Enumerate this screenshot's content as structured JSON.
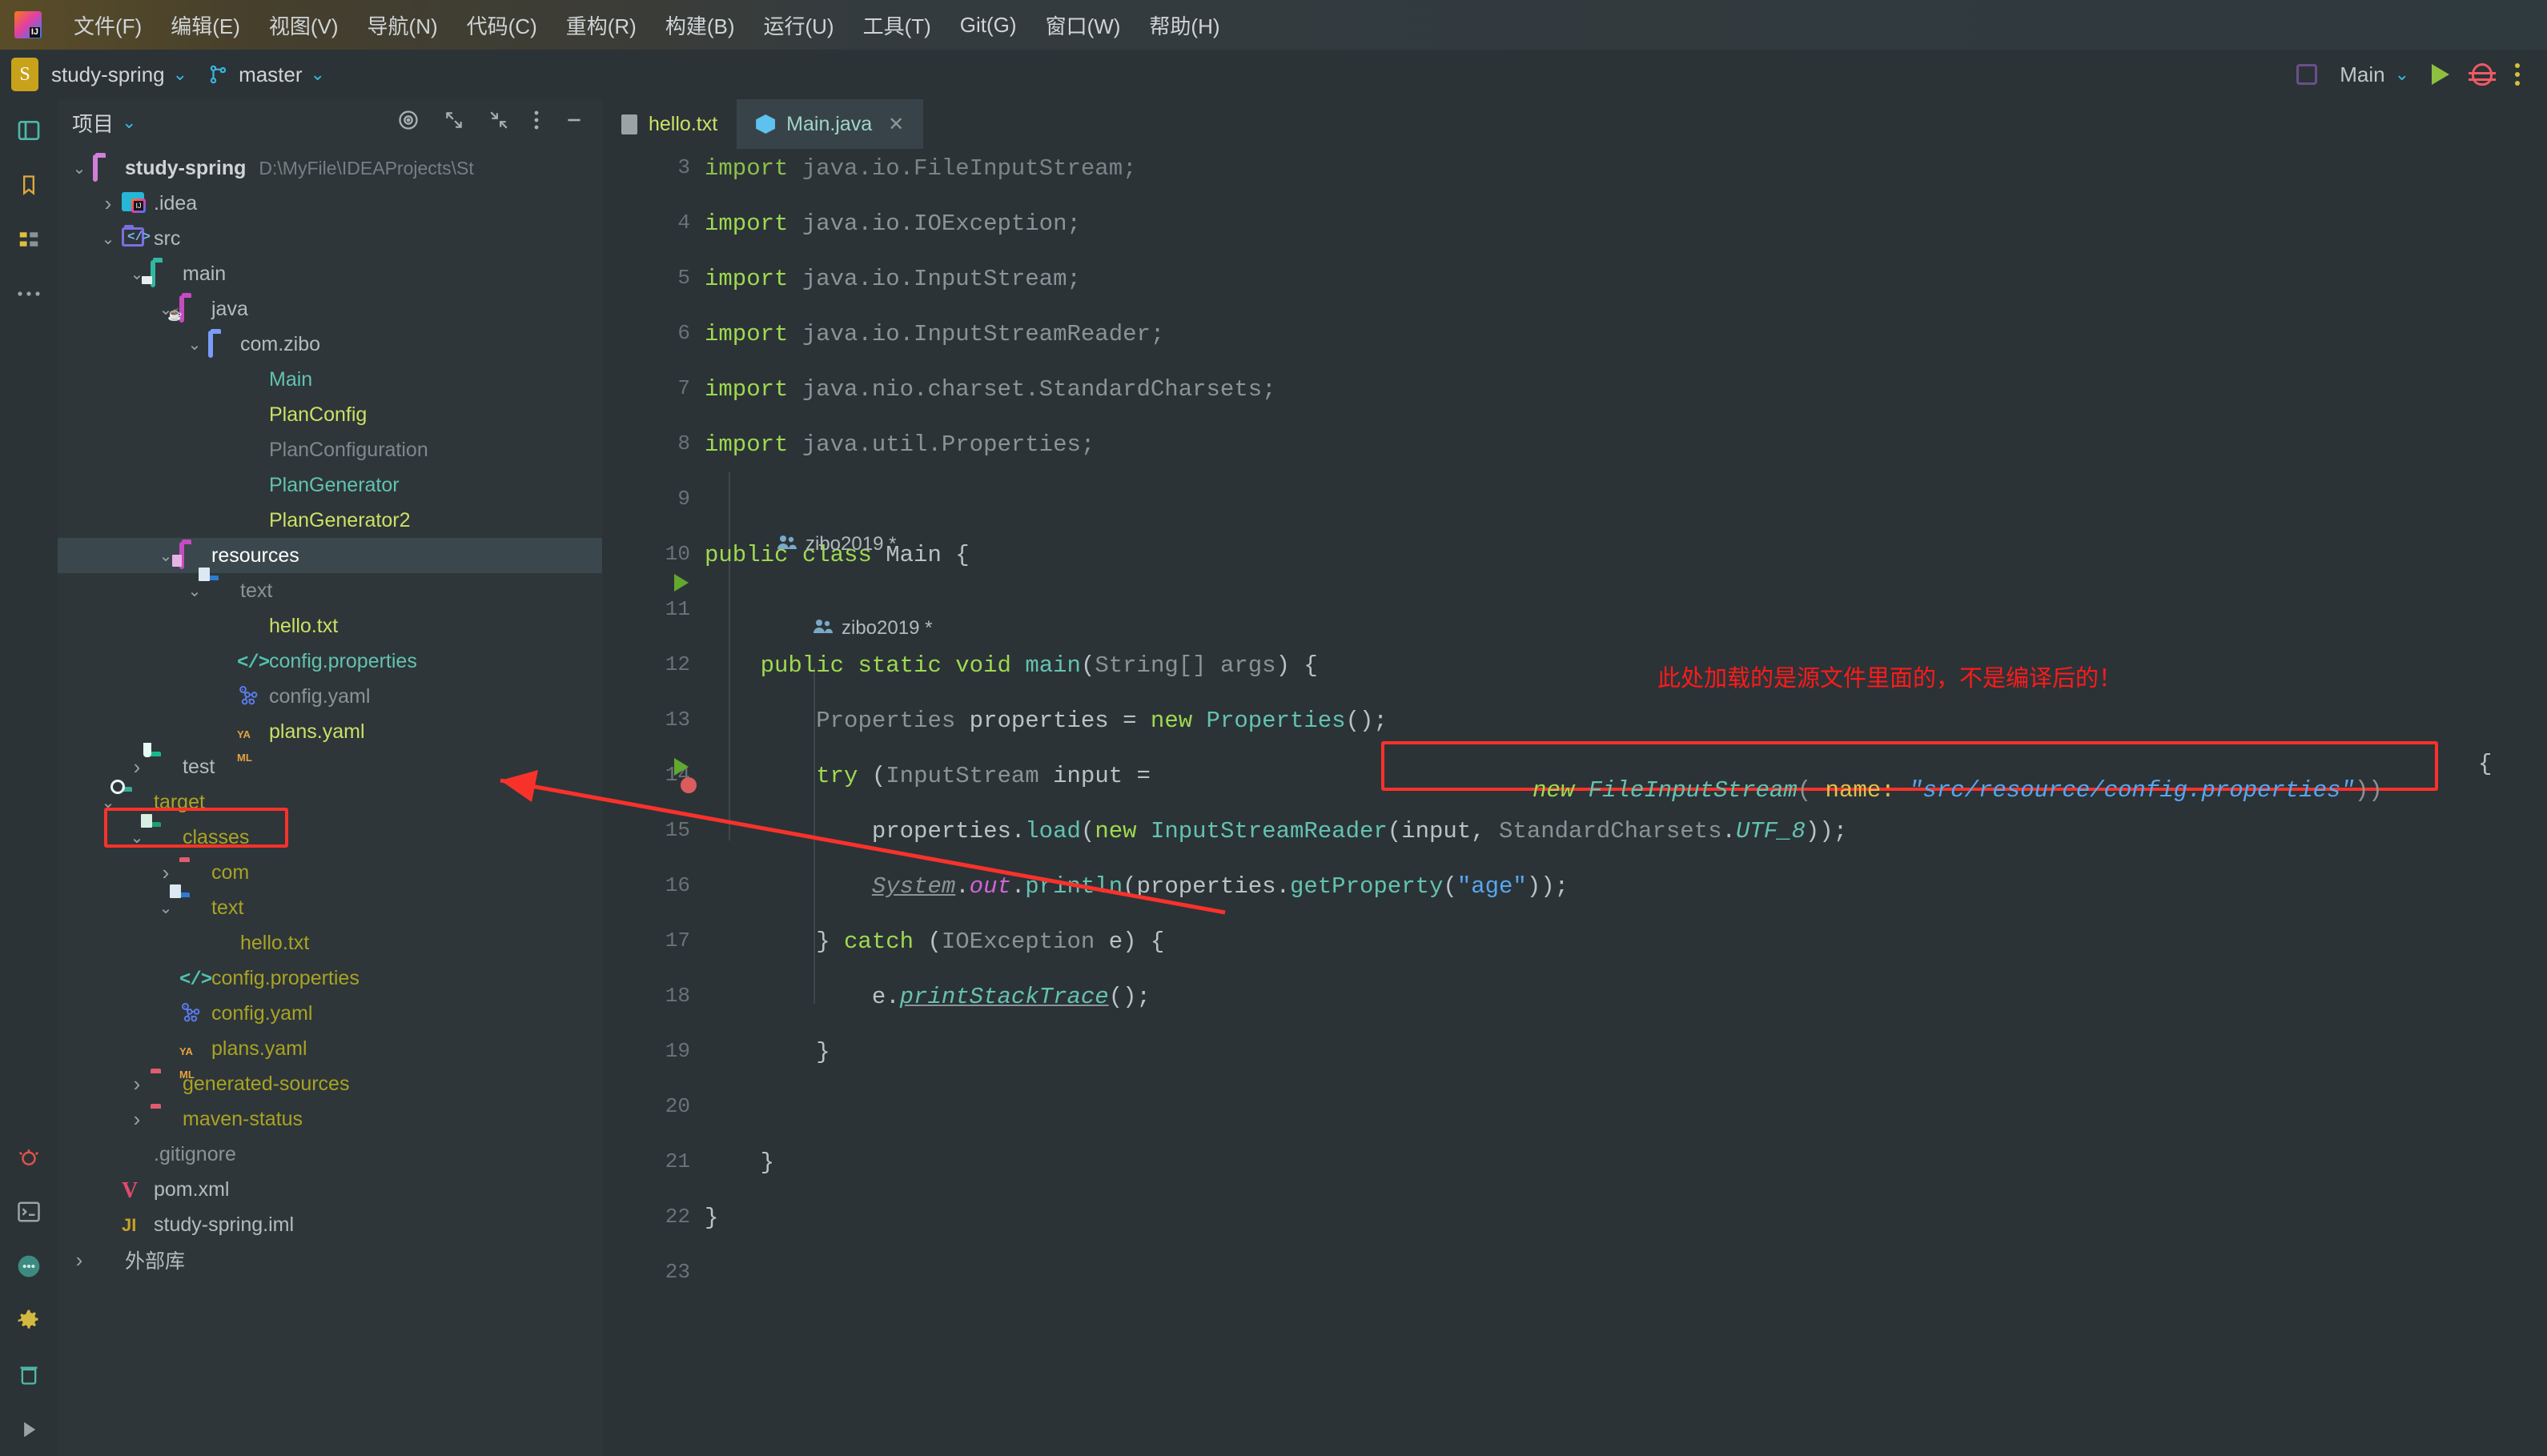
{
  "menu": {
    "items": [
      {
        "label": "文件(F)",
        "mnemonic": "F"
      },
      {
        "label": "编辑(E)",
        "mnemonic": "E"
      },
      {
        "label": "视图(V)",
        "mnemonic": "V"
      },
      {
        "label": "导航(N)",
        "mnemonic": "N"
      },
      {
        "label": "代码(C)",
        "mnemonic": "C"
      },
      {
        "label": "重构(R)",
        "mnemonic": "R"
      },
      {
        "label": "构建(B)",
        "mnemonic": "B"
      },
      {
        "label": "运行(U)",
        "mnemonic": "U"
      },
      {
        "label": "工具(T)",
        "mnemonic": "T"
      },
      {
        "label": "Git(G)",
        "mnemonic": "G"
      },
      {
        "label": "窗口(W)",
        "mnemonic": "W"
      },
      {
        "label": "帮助(H)",
        "mnemonic": "H"
      }
    ]
  },
  "projectbar": {
    "badge": "S",
    "project_name": "study-spring",
    "branch_name": "master",
    "run_config": "Main"
  },
  "toolwindow": {
    "title": "项目",
    "root": {
      "label": "study-spring",
      "path": "D:\\MyFile\\IDEAProjects\\St"
    },
    "items": [
      {
        "label": ".idea",
        "indent": 1,
        "arrow": "collapsed",
        "icon": "idea-folder-icon",
        "color": "#b3bcbf"
      },
      {
        "label": "src",
        "indent": 1,
        "arrow": "expanded",
        "icon": "src-folder-icon",
        "color": "#b3bcbf"
      },
      {
        "label": "main",
        "indent": 2,
        "arrow": "expanded",
        "icon": "main-folder-icon",
        "color": "#b3bcbf"
      },
      {
        "label": "java",
        "indent": 3,
        "arrow": "expanded",
        "icon": "java-folder-icon",
        "color": "#b3bcbf"
      },
      {
        "label": "com.zibo",
        "indent": 4,
        "arrow": "expanded",
        "icon": "package-folder-icon",
        "color": "#b3bcbf"
      },
      {
        "label": "Main",
        "indent": 5,
        "arrow": "none",
        "icon": "java-class-run-icon",
        "color": "#63c2b0"
      },
      {
        "label": "PlanConfig",
        "indent": 5,
        "arrow": "none",
        "icon": "java-class-run-icon",
        "color": "#c9e265"
      },
      {
        "label": "PlanConfiguration",
        "indent": 5,
        "arrow": "none",
        "icon": "java-class-icon",
        "color": "#7f888c"
      },
      {
        "label": "PlanGenerator",
        "indent": 5,
        "arrow": "none",
        "icon": "java-class-run-icon",
        "color": "#63c2b0"
      },
      {
        "label": "PlanGenerator2",
        "indent": 5,
        "arrow": "none",
        "icon": "java-class-run-icon",
        "color": "#c9e265"
      },
      {
        "label": "resources",
        "indent": 3,
        "arrow": "expanded",
        "icon": "resources-folder-icon",
        "color": "#ffffff",
        "selected": true
      },
      {
        "label": "text",
        "indent": 4,
        "arrow": "expanded",
        "icon": "text-folder-icon",
        "color": "#8a9396"
      },
      {
        "label": "hello.txt",
        "indent": 5,
        "arrow": "none",
        "icon": "text-file-icon",
        "color": "#c9e265"
      },
      {
        "label": "config.properties",
        "indent": 5,
        "arrow": "none",
        "icon": "properties-file-icon",
        "color": "#63c2b0",
        "highlighted": true
      },
      {
        "label": "config.yaml",
        "indent": 5,
        "arrow": "none",
        "icon": "spring-yaml-icon",
        "color": "#8a9396"
      },
      {
        "label": "plans.yaml",
        "indent": 5,
        "arrow": "none",
        "icon": "yaml-file-icon",
        "color": "#c9e265"
      },
      {
        "label": "test",
        "indent": 2,
        "arrow": "collapsed",
        "icon": "test-folder-icon",
        "color": "#b3bcbf"
      },
      {
        "label": "target",
        "indent": 1,
        "arrow": "expanded",
        "icon": "target-folder-icon",
        "color": "#a9a324"
      },
      {
        "label": "classes",
        "indent": 2,
        "arrow": "expanded",
        "icon": "classes-folder-icon",
        "color": "#a9a324"
      },
      {
        "label": "com",
        "indent": 3,
        "arrow": "collapsed",
        "icon": "excluded-folder-icon",
        "color": "#a9a324"
      },
      {
        "label": "text",
        "indent": 3,
        "arrow": "expanded",
        "icon": "text-folder-icon",
        "color": "#a9a324"
      },
      {
        "label": "hello.txt",
        "indent": 4,
        "arrow": "none",
        "icon": "text-file-icon",
        "color": "#a9a324"
      },
      {
        "label": "config.properties",
        "indent": 3,
        "arrow": "none",
        "icon": "properties-file-icon",
        "color": "#a9a324"
      },
      {
        "label": "config.yaml",
        "indent": 3,
        "arrow": "none",
        "icon": "spring-yaml-icon",
        "color": "#a9a324"
      },
      {
        "label": "plans.yaml",
        "indent": 3,
        "arrow": "none",
        "icon": "yaml-file-icon",
        "color": "#a9a324"
      },
      {
        "label": "generated-sources",
        "indent": 2,
        "arrow": "collapsed",
        "icon": "excluded-folder-icon",
        "color": "#a9a324"
      },
      {
        "label": "maven-status",
        "indent": 2,
        "arrow": "collapsed",
        "icon": "excluded-folder-icon",
        "color": "#a9a324"
      },
      {
        "label": ".gitignore",
        "indent": 1,
        "arrow": "none",
        "icon": "git-file-icon",
        "color": "#8a9396"
      },
      {
        "label": "pom.xml",
        "indent": 1,
        "arrow": "none",
        "icon": "maven-file-icon",
        "color": "#b3bcbf"
      },
      {
        "label": "study-spring.iml",
        "indent": 1,
        "arrow": "none",
        "icon": "iml-file-icon",
        "color": "#b3bcbf"
      },
      {
        "label": "外部库",
        "indent": 0,
        "arrow": "collapsed",
        "icon": "external-library-icon",
        "color": "#b3bcbf"
      }
    ]
  },
  "editor": {
    "tabs": [
      {
        "label": "hello.txt",
        "icon": "text-file-icon",
        "active": false,
        "closable": false
      },
      {
        "label": "Main.java",
        "icon": "java-class-icon",
        "active": true,
        "closable": true,
        "close_label": "✕"
      }
    ],
    "line_numbers": [
      "3",
      "4",
      "5",
      "6",
      "7",
      "8",
      "9",
      "10",
      "11",
      "12",
      "13",
      "14",
      "15",
      "16",
      "17",
      "18",
      "19",
      "20",
      "21",
      "22",
      "23"
    ],
    "code_lines": [
      {
        "n": "3",
        "html": "<span class=\"kw\">import</span> <span class=\"gy\">java.io.FileInputStream;</span>",
        "clipped": true
      },
      {
        "n": "4",
        "html": "<span class=\"kw\">import</span> <span class=\"gy\">java.io.IOException;</span>"
      },
      {
        "n": "5",
        "html": "<span class=\"kw\">import</span> <span class=\"gy\">java.io.InputStream;</span>"
      },
      {
        "n": "6",
        "html": "<span class=\"kw\">import</span> <span class=\"gy\">java.io.InputStreamReader;</span>"
      },
      {
        "n": "7",
        "html": "<span class=\"kw\">import</span> <span class=\"gy\">java.nio.charset.StandardCharsets;</span>"
      },
      {
        "n": "8",
        "html": "<span class=\"kw\">import</span> <span class=\"gy\">java.util.Properties;</span>"
      },
      {
        "n": "9",
        "html": ""
      },
      {
        "n": "10",
        "html": "<span class=\"kw\">public</span> <span class=\"kw\">class</span> <span class=\"pl\">Main</span> {",
        "runmarker": true
      },
      {
        "n": "11",
        "html": ""
      },
      {
        "n": "12",
        "html": "    <span class=\"kw\">public</span> <span class=\"kw\">static</span> <span class=\"kw\">void</span> <span class=\"ty\">main</span>(<span class=\"gy\">String[] args</span>) {",
        "runmarker": true
      },
      {
        "n": "13",
        "html": "        <span class=\"gy\">Properties</span> <span class=\"pl\">properties</span> = <span class=\"kw\">new</span> <span class=\"ty\">Properties</span>();"
      },
      {
        "n": "14",
        "html": "        <span class=\"kw\">try</span> (<span class=\"gy\">InputStream</span> <span class=\"pl\">input</span> = "
      },
      {
        "n": "15",
        "html": "            <span class=\"pl\">properties</span>.<span class=\"ty\">load</span>(<span class=\"kw\">new</span> <span class=\"ty\">InputStreamReader</span>(<span class=\"pl\">input</span>, <span class=\"gy\">StandardCharsets</span>.<span class=\"ty it\">UTF_8</span>));"
      },
      {
        "n": "16",
        "html": "            <span class=\"gy it ud\">System</span>.<span class=\"pk it\">out</span>.<span class=\"ty\">println</span>(<span class=\"pl\">properties</span>.<span class=\"ty\">getProperty</span>(<span class=\"st\">\"age\"</span>));"
      },
      {
        "n": "17",
        "html": "        } <span class=\"kw\">catch</span> (<span class=\"gy\">IOException</span> <span class=\"pl\">e</span>) {"
      },
      {
        "n": "18",
        "html": "            <span class=\"pl\">e</span>.<span class=\"ty it ud\">printStackTrace</span>();"
      },
      {
        "n": "19",
        "html": "        }"
      },
      {
        "n": "20",
        "html": ""
      },
      {
        "n": "21",
        "html": "    }"
      },
      {
        "n": "22",
        "html": "}"
      },
      {
        "n": "23",
        "html": ""
      }
    ],
    "highlighted_expression": {
      "new_kw": "new",
      "class_name": "FileInputStream",
      "param_hint": "name:",
      "string_value": "\"src/resource/config.properties\"",
      "trailing": "))",
      "after": "{"
    },
    "code_vision": [
      {
        "label": "zibo2019 *",
        "icon": "users-icon"
      },
      {
        "label": "zibo2019 *",
        "icon": "users-icon"
      }
    ],
    "annotation_text": "此处加载的是源文件里面的，不是编译后的！",
    "annotation_color": "#ff1a1a"
  },
  "colors": {
    "accent_red": "#f8322b",
    "bg_editor": "#2b3337",
    "bg_toolwindow": "#2e3639",
    "selection": "#3a474c",
    "keyword_green": "#9fd94f",
    "string_blue": "#58a6f0",
    "type_teal": "#64c2b0"
  }
}
